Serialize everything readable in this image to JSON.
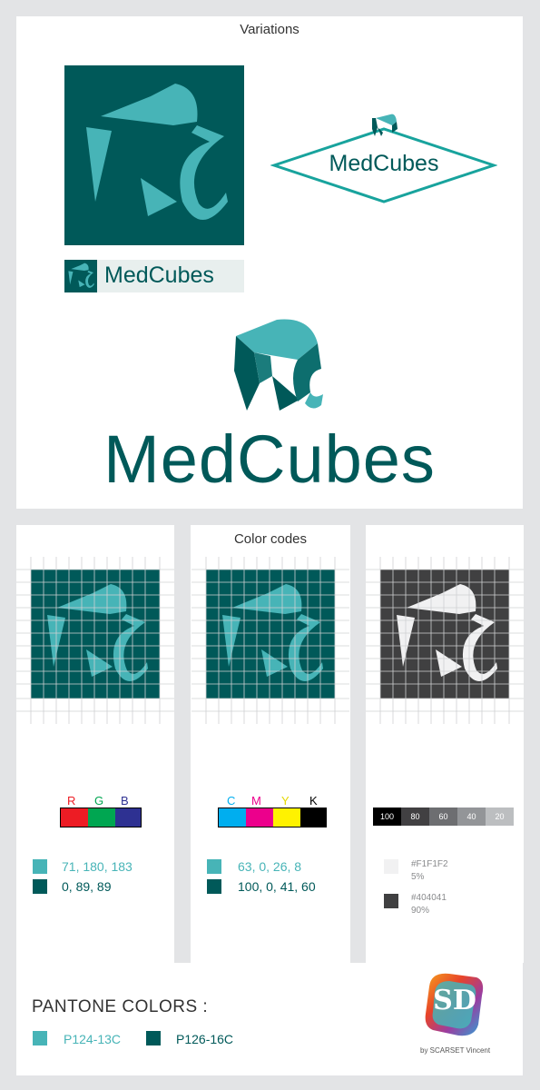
{
  "colors": {
    "teal_light": "#47B4B7",
    "teal_dark": "#005959",
    "gray_light": "#F1F1F2",
    "gray_dark": "#404041",
    "background": "#E3E4E6"
  },
  "variations": {
    "title": "Variations",
    "logo_small_text": "MedCubes",
    "logo_badge_text": "MedCubes",
    "logo_large_text": "MedCubes"
  },
  "color_codes": {
    "title": "Color codes",
    "rgb": {
      "letters": [
        "R",
        "G",
        "B"
      ],
      "colors": [
        "#ED1C24",
        "#00A651",
        "#2E3192"
      ],
      "light_value": "71, 180, 183",
      "dark_value": "0, 89, 89"
    },
    "cmyk": {
      "letters": [
        "C",
        "M",
        "Y",
        "K"
      ],
      "colors": [
        "#00AEEF",
        "#EC008C",
        "#FFF200",
        "#000000"
      ],
      "light_value": "63, 0, 26, 8",
      "dark_value": "100, 0, 41, 60"
    },
    "gray": {
      "steps": [
        "100",
        "80",
        "60",
        "40",
        "20"
      ],
      "step_colors": [
        "#000000",
        "#414042",
        "#6D6E71",
        "#939598",
        "#BCBEC0"
      ],
      "light_hex": "#F1F1F2",
      "light_pct": "5%",
      "dark_hex": "#404041",
      "dark_pct": "90%"
    }
  },
  "pantone": {
    "title": "PANTONE COLORS :",
    "light": "P124-13C",
    "dark": "P126-16C"
  },
  "signature": {
    "monogram": "SD",
    "credit": "by SCARSET Vincent"
  }
}
